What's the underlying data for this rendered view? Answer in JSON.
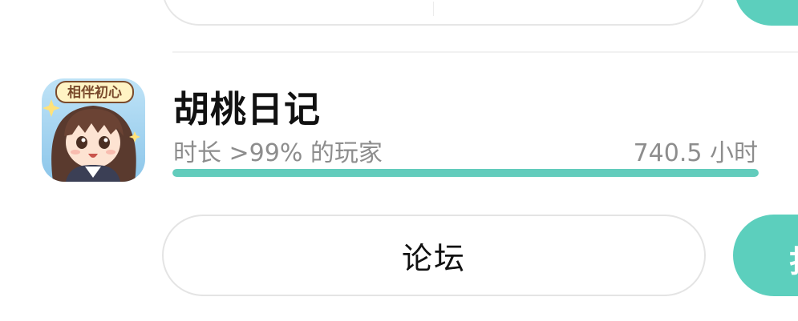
{
  "game": {
    "title": "胡桃日记",
    "icon": "hutao-diary-app-icon",
    "icon_banner_text": "相伴初心",
    "playtime_description": "时长 >99% 的玩家",
    "playtime_hours": "740.5 小时",
    "progress_fraction": 1.0
  },
  "buttons": {
    "forum_label": "论坛",
    "side_action_label": "打"
  },
  "colors": {
    "accent": "#5ccfbd",
    "progress": "#62ccbc",
    "muted_text": "#8d8d8d",
    "title_text": "#111111"
  }
}
